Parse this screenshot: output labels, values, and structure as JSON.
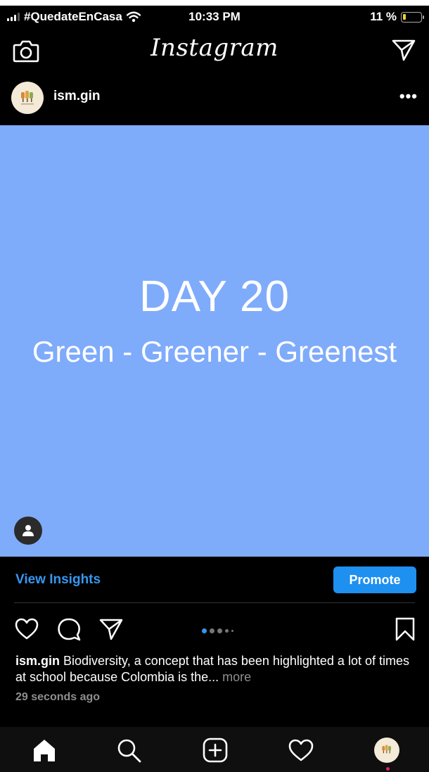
{
  "status_bar": {
    "carrier": "#QuedateEnCasa",
    "time": "10:33 PM",
    "battery": "11 %",
    "battery_level": 0.11
  },
  "app_header": {
    "logo": "Instagram"
  },
  "post": {
    "username": "ism.gin",
    "more_label": "•••",
    "image_title": "DAY 20",
    "image_subtitle": "Green - Greener - Greenest",
    "image_color": "#7fabfb",
    "carousel_total": 5,
    "carousel_active": 1
  },
  "insights": {
    "view_label": "View Insights",
    "promote_label": "Promote",
    "accent": "#3797f0"
  },
  "caption": {
    "username": "ism.gin",
    "text": " Biodiversity, a concept that has been highlighted a lot of times at school because Colombia is the...",
    "more": " more",
    "timestamp": "29 seconds ago"
  },
  "icons": {
    "header": [
      "camera-icon",
      "direct-message-icon"
    ],
    "actions": [
      "heart-icon",
      "comment-icon",
      "share-icon",
      "bookmark-icon"
    ],
    "nav": [
      "home-icon",
      "search-icon",
      "new-post-icon",
      "activity-icon",
      "profile-avatar"
    ]
  }
}
